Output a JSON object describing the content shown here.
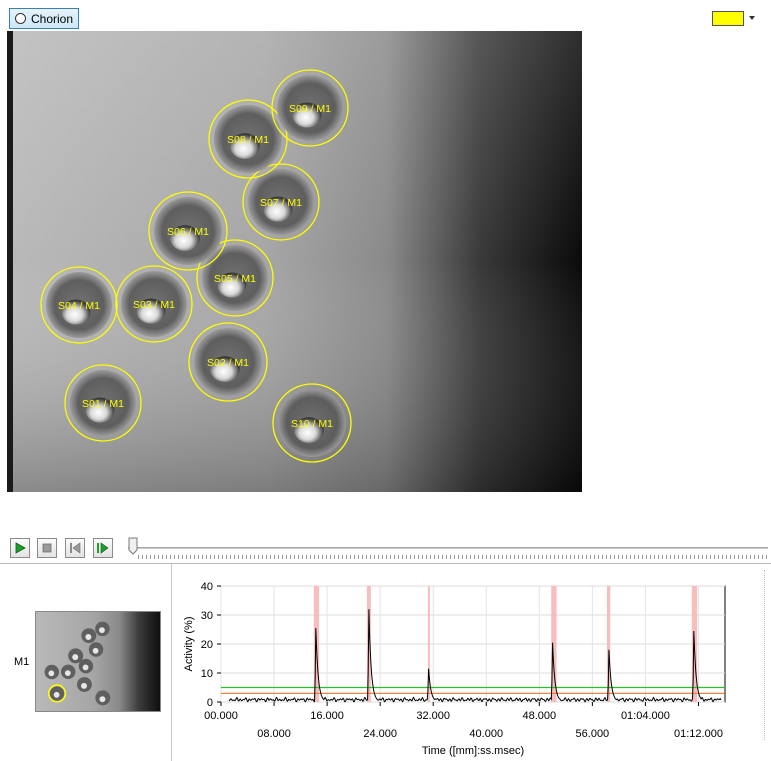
{
  "toolbar": {
    "layer_button_label": "Chorion",
    "overlay_color": "#ffff00"
  },
  "video": {
    "roi_color": "#ffff00",
    "rois": [
      {
        "label": "S01 / M1"
      },
      {
        "label": "S02 / M1"
      },
      {
        "label": "S03 / M1"
      },
      {
        "label": "S04 / M1"
      },
      {
        "label": "S05 / M1"
      },
      {
        "label": "S06 / M1"
      },
      {
        "label": "S07 / M1"
      },
      {
        "label": "S08 / M1"
      },
      {
        "label": "S09 / M1"
      },
      {
        "label": "S10 / M1"
      }
    ]
  },
  "playback": {
    "buttons": [
      "play",
      "stop",
      "step-back",
      "step-forward"
    ],
    "position_fraction": 0.0
  },
  "bottom": {
    "row_label": "M1"
  },
  "chart_data": {
    "type": "line",
    "xlabel": "Time ([mm]:ss.msec)",
    "ylabel": "Activity (%)",
    "xlim": [
      0,
      76
    ],
    "ylim": [
      0,
      40
    ],
    "y_ticks": [
      0,
      10,
      20,
      30,
      40
    ],
    "x_ticks_upper": [
      {
        "t": 0,
        "label": "00.000"
      },
      {
        "t": 16,
        "label": "16.000"
      },
      {
        "t": 32,
        "label": "32.000"
      },
      {
        "t": 48,
        "label": "48.000"
      },
      {
        "t": 64,
        "label": "01:04.000"
      }
    ],
    "x_ticks_lower": [
      {
        "t": 8,
        "label": "08.000"
      },
      {
        "t": 24,
        "label": "24.000"
      },
      {
        "t": 40,
        "label": "40.000"
      },
      {
        "t": 56,
        "label": "56.000"
      },
      {
        "t": 72,
        "label": "01:12.000"
      }
    ],
    "grid": true,
    "thresholds": [
      {
        "value": 5,
        "color": "#2bbf2b"
      },
      {
        "value": 3,
        "color": "#e07b2a"
      }
    ],
    "event_color": "#f6b3b3",
    "events": [
      {
        "start": 14.0,
        "end": 14.8
      },
      {
        "start": 22.0,
        "end": 22.6
      },
      {
        "start": 31.2,
        "end": 31.5
      },
      {
        "start": 49.8,
        "end": 50.6
      },
      {
        "start": 58.2,
        "end": 58.7
      },
      {
        "start": 71.0,
        "end": 71.8
      }
    ],
    "series": [
      {
        "color": "#000000",
        "baseline": 0.8,
        "peaks": [
          {
            "t": 14.3,
            "value": 25.5
          },
          {
            "t": 22.3,
            "value": 32.0
          },
          {
            "t": 31.3,
            "value": 11.5
          },
          {
            "t": 50.0,
            "value": 20.5
          },
          {
            "t": 58.5,
            "value": 18.0
          },
          {
            "t": 71.3,
            "value": 24.5
          }
        ]
      }
    ]
  }
}
